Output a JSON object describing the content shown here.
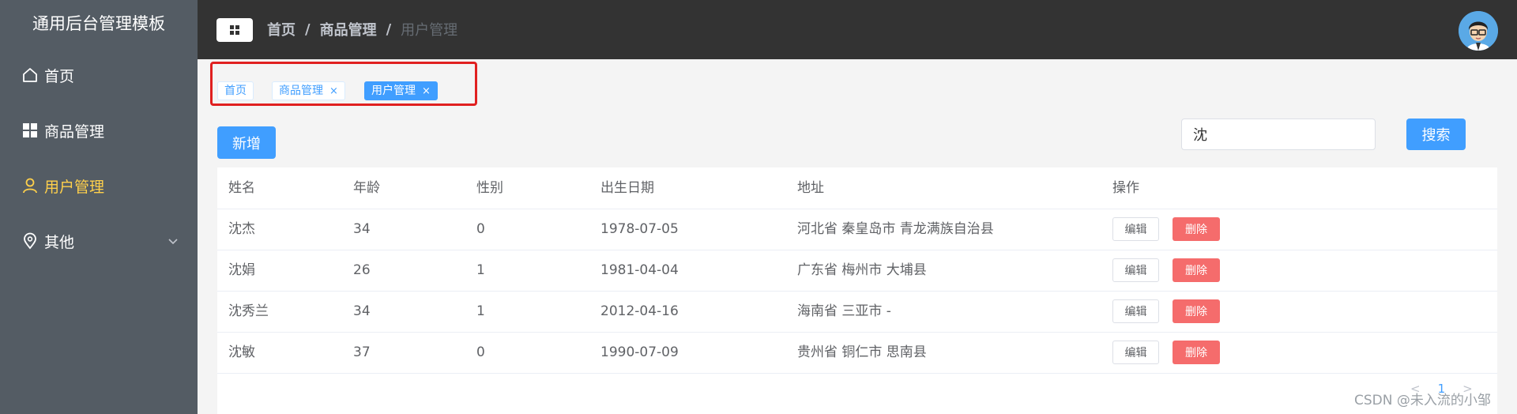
{
  "sidebar": {
    "title": "通用后台管理模板",
    "items": [
      {
        "label": "首页",
        "icon": "home-icon"
      },
      {
        "label": "商品管理",
        "icon": "grid-icon"
      },
      {
        "label": "用户管理",
        "icon": "user-icon",
        "active": true
      },
      {
        "label": "其他",
        "icon": "location-icon",
        "has_submenu": true
      }
    ]
  },
  "header": {
    "breadcrumb": [
      "首页",
      "商品管理",
      "用户管理"
    ],
    "breadcrumb_separator": "/"
  },
  "tags": [
    {
      "label": "首页",
      "closable": false
    },
    {
      "label": "商品管理",
      "closable": true,
      "close": "×"
    },
    {
      "label": "用户管理",
      "closable": true,
      "close": "×",
      "active": true
    }
  ],
  "toolbar": {
    "add_label": "新增",
    "search_value": "沈",
    "search_label": "搜索"
  },
  "table": {
    "columns": [
      "姓名",
      "年龄",
      "性别",
      "出生日期",
      "地址",
      "操作"
    ],
    "rows": [
      {
        "name": "沈杰",
        "age": "34",
        "sex": "0",
        "birth": "1978-07-05",
        "addr": "河北省 秦皇岛市 青龙满族自治县"
      },
      {
        "name": "沈娟",
        "age": "26",
        "sex": "1",
        "birth": "1981-04-04",
        "addr": "广东省 梅州市 大埔县"
      },
      {
        "name": "沈秀兰",
        "age": "34",
        "sex": "1",
        "birth": "2012-04-16",
        "addr": "海南省 三亚市 -"
      },
      {
        "name": "沈敏",
        "age": "37",
        "sex": "0",
        "birth": "1990-07-09",
        "addr": "贵州省 铜仁市 思南县"
      }
    ],
    "edit_label": "编辑",
    "delete_label": "删除"
  },
  "pagination": {
    "prev": "<",
    "page": "1",
    "next": ">"
  },
  "watermark": "CSDN @未入流的小邹",
  "colors": {
    "sidebar_bg": "#545c64",
    "active_menu": "#ffd04b",
    "topbar_bg": "#333333",
    "primary": "#409eff",
    "danger": "#f56c6c",
    "highlight_box": "#e02020"
  }
}
